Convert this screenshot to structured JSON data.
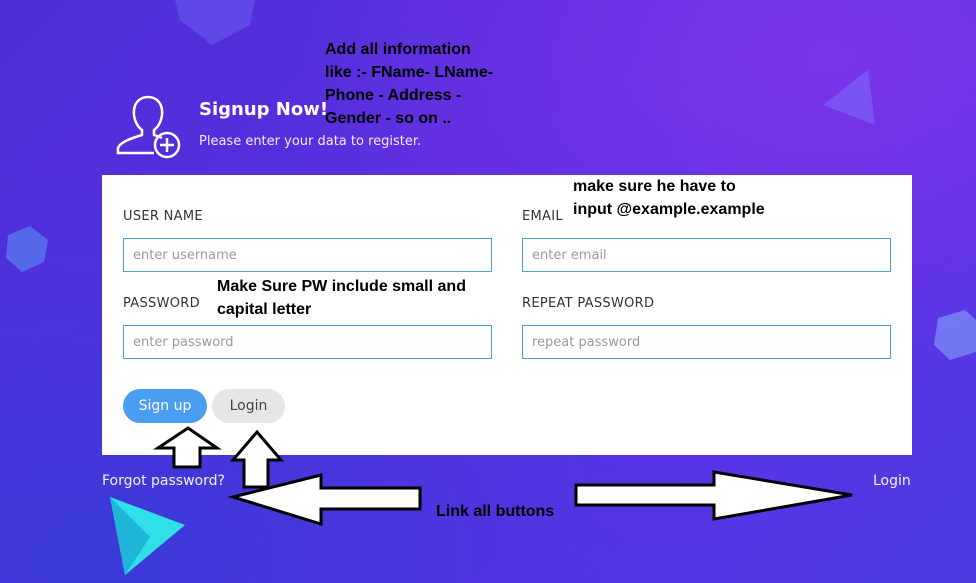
{
  "header": {
    "title": "Signup Now!",
    "subtitle": "Please enter your data to register.",
    "icon": "user-add-icon"
  },
  "form": {
    "username": {
      "label": "USER NAME",
      "placeholder": "enter username"
    },
    "email": {
      "label": "EMAIL",
      "placeholder": "enter email"
    },
    "password": {
      "label": "PASSWORD",
      "placeholder": "enter password"
    },
    "repeat_password": {
      "label": "REPEAT PASSWORD",
      "placeholder": "repeat password"
    }
  },
  "buttons": {
    "signup": "Sign up",
    "login": "Login"
  },
  "footer": {
    "forgot": "Forgot password?",
    "login": "Login"
  },
  "annotations": {
    "info_line1": "Add all information",
    "info_line2": "like :- FName- LName-",
    "info_line3": "Phone - Address -",
    "info_line4": "Gender - so on ..",
    "email_line1": "make sure he have to",
    "email_line2": "input @example.example",
    "pw_line1": "Make Sure PW include small and",
    "pw_line2": "capital letter",
    "link_all": "Link all buttons"
  },
  "colors": {
    "background": "#5530e0",
    "primary_button": "#4a9ef2",
    "secondary_button": "#e6e6e6",
    "field_border": "#4aa0d8"
  }
}
